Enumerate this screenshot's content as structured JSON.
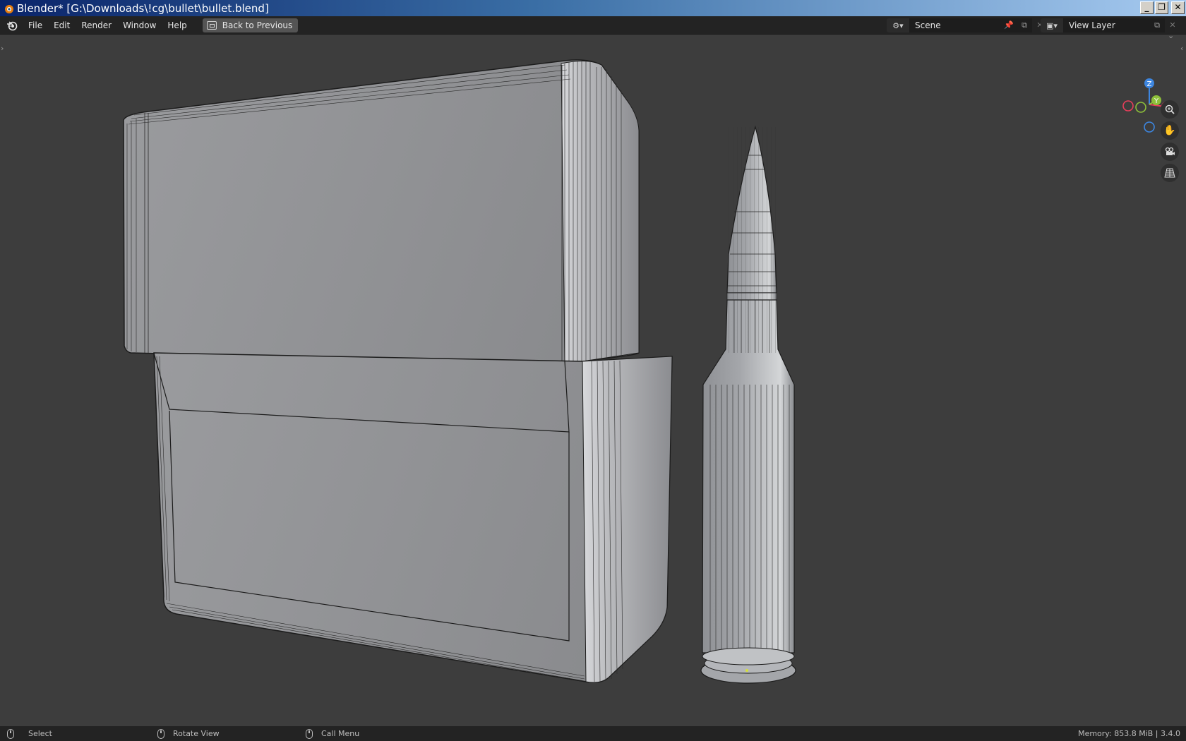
{
  "window": {
    "title": "Blender* [G:\\Downloads\\!cg\\bullet\\bullet.blend]"
  },
  "menu": {
    "items": [
      "File",
      "Edit",
      "Render",
      "Window",
      "Help"
    ],
    "back_button": "Back to Previous"
  },
  "scene": {
    "name": "Scene"
  },
  "view_layer": {
    "name": "View Layer"
  },
  "gizmo": {
    "z": "Z",
    "y": "Y",
    "x": "X"
  },
  "statusbar": {
    "select": "Select",
    "rotate": "Rotate View",
    "call_menu": "Call Menu",
    "memory": "Memory: 853.8 MiB | 3.4.0"
  },
  "colors": {
    "title_gradient_start": "#0a246a",
    "title_gradient_end": "#a6caf0",
    "axis_x": "#e83e5a",
    "axis_y": "#8ec03a",
    "axis_z": "#3d86e0",
    "viewport_bg": "#3d3d3d"
  }
}
